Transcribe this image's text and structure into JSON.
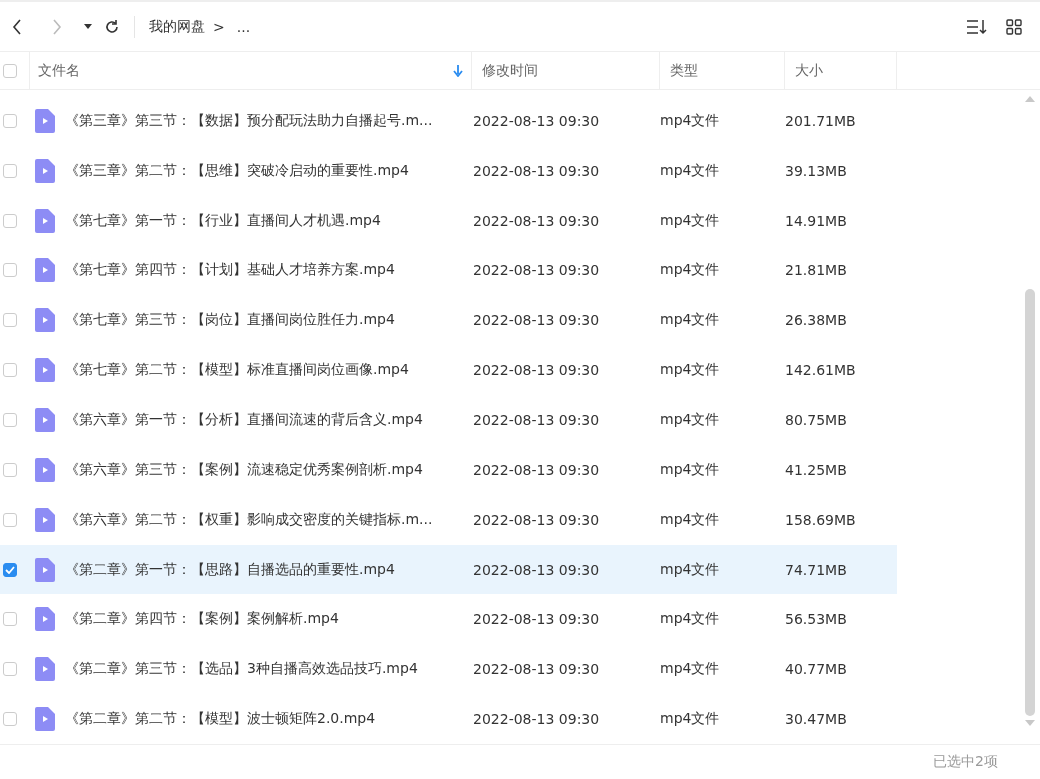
{
  "toolbar": {
    "breadcrumb": "我的网盘",
    "separator": ">",
    "ellipsis": "..."
  },
  "table": {
    "columns": [
      {
        "label": "文件名",
        "sorted": true
      },
      {
        "label": "修改时间",
        "sorted": false
      },
      {
        "label": "类型",
        "sorted": false
      },
      {
        "label": "大小",
        "sorted": false
      }
    ],
    "header_checked": false,
    "rows": [
      {
        "name": "《第三章》第三节：【数据】预分配玩法助力自播起号.m...",
        "modified": "2022-08-13 09:30",
        "type": "mp4文件",
        "size": "201.71MB",
        "checked": false
      },
      {
        "name": "《第三章》第二节：【思维】突破冷启动的重要性.mp4",
        "modified": "2022-08-13 09:30",
        "type": "mp4文件",
        "size": "39.13MB",
        "checked": false
      },
      {
        "name": "《第七章》第一节：【行业】直播间人才机遇.mp4",
        "modified": "2022-08-13 09:30",
        "type": "mp4文件",
        "size": "14.91MB",
        "checked": false
      },
      {
        "name": "《第七章》第四节：【计划】基础人才培养方案.mp4",
        "modified": "2022-08-13 09:30",
        "type": "mp4文件",
        "size": "21.81MB",
        "checked": false
      },
      {
        "name": "《第七章》第三节：【岗位】直播间岗位胜任力.mp4",
        "modified": "2022-08-13 09:30",
        "type": "mp4文件",
        "size": "26.38MB",
        "checked": false
      },
      {
        "name": "《第七章》第二节：【模型】标准直播间岗位画像.mp4",
        "modified": "2022-08-13 09:30",
        "type": "mp4文件",
        "size": "142.61MB",
        "checked": false
      },
      {
        "name": "《第六章》第一节：【分析】直播间流速的背后含义.mp4",
        "modified": "2022-08-13 09:30",
        "type": "mp4文件",
        "size": "80.75MB",
        "checked": false
      },
      {
        "name": "《第六章》第三节：【案例】流速稳定优秀案例剖析.mp4",
        "modified": "2022-08-13 09:30",
        "type": "mp4文件",
        "size": "41.25MB",
        "checked": false
      },
      {
        "name": "《第六章》第二节：【权重】影响成交密度的关键指标.m...",
        "modified": "2022-08-13 09:30",
        "type": "mp4文件",
        "size": "158.69MB",
        "checked": false
      },
      {
        "name": "《第二章》第一节：【思路】自播选品的重要性.mp4",
        "modified": "2022-08-13 09:30",
        "type": "mp4文件",
        "size": "74.71MB",
        "checked": true
      },
      {
        "name": "《第二章》第四节：【案例】案例解析.mp4",
        "modified": "2022-08-13 09:30",
        "type": "mp4文件",
        "size": "56.53MB",
        "checked": false
      },
      {
        "name": "《第二章》第三节：【选品】3种自播高效选品技巧.mp4",
        "modified": "2022-08-13 09:30",
        "type": "mp4文件",
        "size": "40.77MB",
        "checked": false
      },
      {
        "name": "《第二章》第二节：【模型】波士顿矩阵2.0.mp4",
        "modified": "2022-08-13 09:30",
        "type": "mp4文件",
        "size": "30.47MB",
        "checked": false
      }
    ]
  },
  "status_bar": {
    "text": "已选中2项"
  }
}
